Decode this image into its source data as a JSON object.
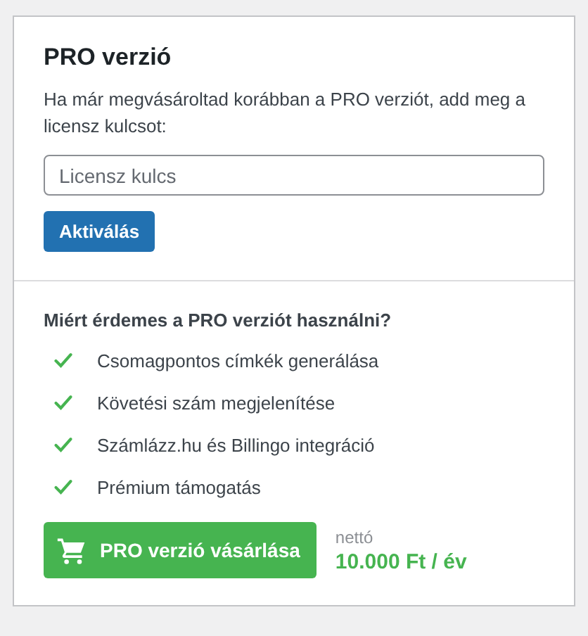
{
  "title": "PRO verzió",
  "description": "Ha már megvásároltad korábban a PRO verziót, add meg a licensz kulcsot:",
  "license_field": {
    "placeholder": "Licensz kulcs"
  },
  "activate_button": "Aktiválás",
  "benefits_heading": "Miért érdemes a PRO verziót használni?",
  "benefits": [
    "Csomagpontos címkék generálása",
    "Követési szám megjelenítése",
    "Számlázz.hu és Billingo integráció",
    "Prémium támogatás"
  ],
  "buy_button": "PRO verzió vásárlása",
  "price_note": "nettó",
  "price": "10.000 Ft / év"
}
